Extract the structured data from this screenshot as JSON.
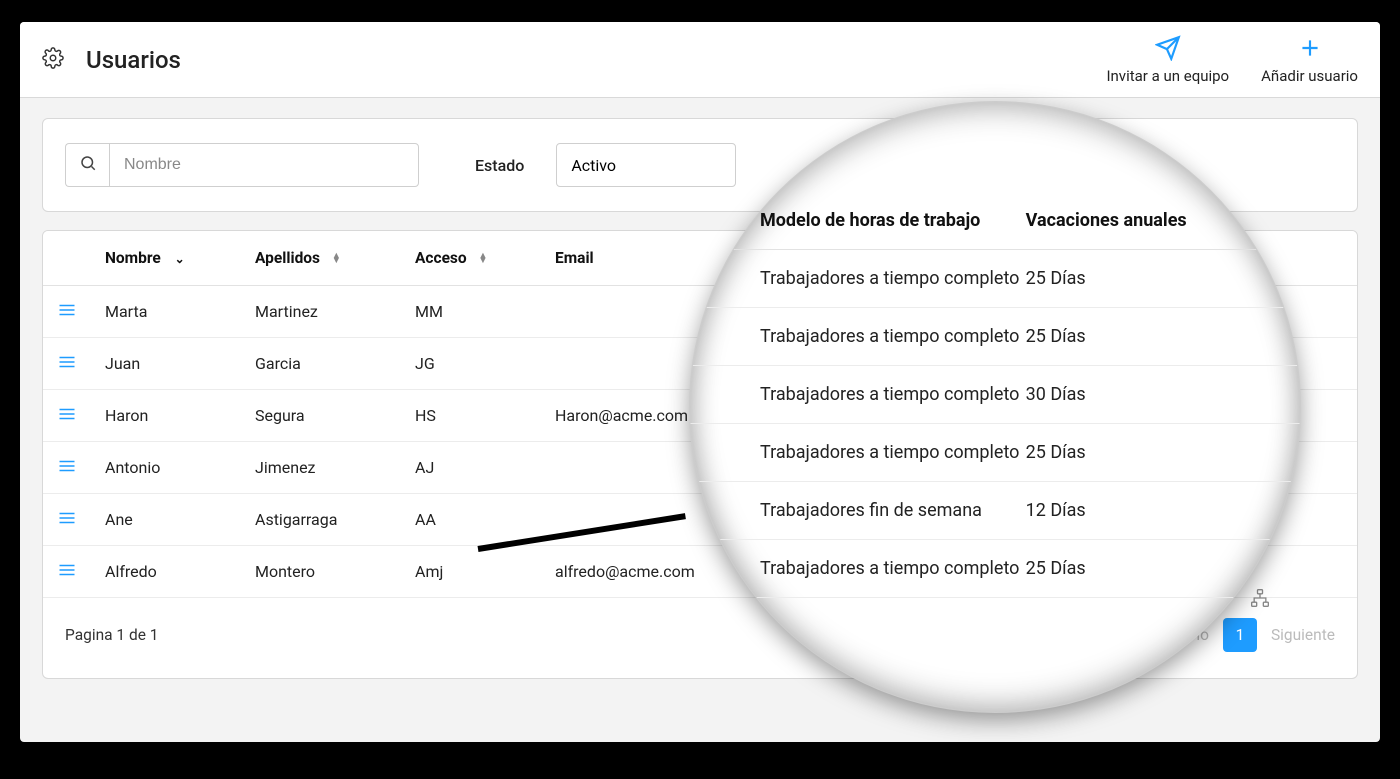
{
  "header": {
    "title": "Usuarios",
    "invite_label": "Invitar a un equipo",
    "add_user_label": "Añadir usuario"
  },
  "filters": {
    "search_placeholder": "Nombre",
    "state_label": "Estado",
    "state_value": "Activo"
  },
  "table": {
    "columns": {
      "nombre": "Nombre",
      "apellidos": "Apellidos",
      "acceso": "Acceso",
      "email": "Email"
    },
    "rows": [
      {
        "nombre": "Marta",
        "apellidos": "Martinez",
        "acceso": "MM",
        "email": ""
      },
      {
        "nombre": "Juan",
        "apellidos": "Garcia",
        "acceso": "JG",
        "email": ""
      },
      {
        "nombre": "Haron",
        "apellidos": "Segura",
        "acceso": "HS",
        "email": "Haron@acme.com"
      },
      {
        "nombre": "Antonio",
        "apellidos": "Jimenez",
        "acceso": "AJ",
        "email": ""
      },
      {
        "nombre": "Ane",
        "apellidos": "Astigarraga",
        "acceso": "AA",
        "email": ""
      },
      {
        "nombre": "Alfredo",
        "apellidos": "Montero",
        "acceso": "Amj",
        "email": "alfredo@acme.com"
      }
    ]
  },
  "pagination": {
    "info": "Pagina 1 de 1",
    "prev": "Previo",
    "current": "1",
    "next": "Siguiente"
  },
  "magnifier": {
    "col_model": "Modelo de horas de trabajo",
    "col_vac": "Vacaciones anuales",
    "rows": [
      {
        "model": "Trabajadores a tiempo completo",
        "vac": "25 Días"
      },
      {
        "model": "Trabajadores a tiempo completo",
        "vac": "25 Días"
      },
      {
        "model": "Trabajadores a tiempo completo",
        "vac": "30 Días"
      },
      {
        "model": "Trabajadores a tiempo completo",
        "vac": "25 Días"
      },
      {
        "model": "Trabajadores fin de semana",
        "vac": "12 Días"
      },
      {
        "model": "Trabajadores a tiempo completo",
        "vac": "25 Días"
      }
    ]
  }
}
